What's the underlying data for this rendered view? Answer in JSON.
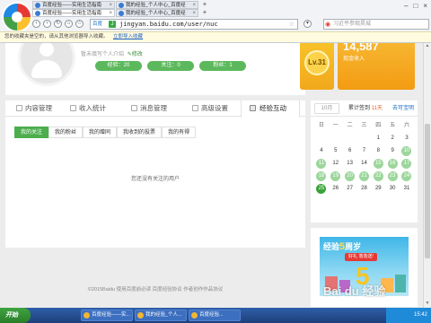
{
  "browser": {
    "tabs": [
      {
        "title": "百度经验——实用生活指南"
      },
      {
        "title": "我的经验_个人中心_百度经"
      },
      {
        "title": "百度经验——实用生活指南"
      },
      {
        "title": "我的经验_个人中心_百度经"
      }
    ],
    "new_tab": "+",
    "address_site": "百度",
    "address_url": "jingyan.baidu.com/user/nuc",
    "address_shield": "J",
    "search_placeholder": "习近平参观昊城",
    "infobar_text": "您的收藏夹是空的，请从其他浏览器导入收藏。",
    "infobar_link": "立即导入收藏"
  },
  "profile": {
    "intro_text": "暂未填写个人介绍",
    "intro_edit": "修改",
    "pills": {
      "experience": "经验：20",
      "follow": "关注：0",
      "fans": "粉丝：1"
    },
    "level": "Lv.31",
    "wealth_value": "14,587",
    "wealth_label": "现金收入"
  },
  "main": {
    "tabs": [
      {
        "label": "内容管理"
      },
      {
        "label": "收入统计"
      },
      {
        "label": "消息管理"
      },
      {
        "label": "高级设置"
      },
      {
        "label": "经验互动"
      }
    ],
    "subtabs": [
      {
        "label": "我的关注"
      },
      {
        "label": "我的粉丝"
      },
      {
        "label": "我的赠同"
      },
      {
        "label": "我收到的投票"
      },
      {
        "label": "我的有得"
      }
    ],
    "empty_message": "您还没有关注的用户"
  },
  "calendar": {
    "month": "10月",
    "streak_prefix": "累计签到",
    "streak_days": "11天",
    "goto_link": "去可宝明",
    "weekdays": [
      "日",
      "一",
      "二",
      "三",
      "四",
      "五",
      "六"
    ],
    "weeks": [
      [
        "",
        "",
        "",
        "",
        "1",
        "2",
        "3"
      ],
      [
        "4",
        "5",
        "6",
        "7",
        "8",
        "9",
        "10"
      ],
      [
        "11",
        "12",
        "13",
        "14",
        "15",
        "16",
        "17"
      ],
      [
        "18",
        "19",
        "20",
        "21",
        "22",
        "23",
        "24"
      ],
      [
        "25",
        "26",
        "27",
        "28",
        "29",
        "30",
        "31"
      ]
    ],
    "signed_days": [
      "10",
      "11",
      "15",
      "16",
      "17",
      "18",
      "19",
      "20",
      "21",
      "22",
      "23",
      "24"
    ],
    "today": "25"
  },
  "ad": {
    "title_prefix": "经验",
    "title_num": "5",
    "title_suffix": "周岁",
    "tag": "好礼 落落送!",
    "big": "5"
  },
  "footer": {
    "text": "©2015Baidu 使用百度前必读 百度经验协议 作者创作作品协议"
  },
  "watermark": "Bai du 经验",
  "taskbar": {
    "start": "开始",
    "items": [
      {
        "label": "百度经验——实..."
      },
      {
        "label": "我的经验_个人..."
      },
      {
        "label": "百度经验..."
      }
    ],
    "clock": "15:42"
  }
}
